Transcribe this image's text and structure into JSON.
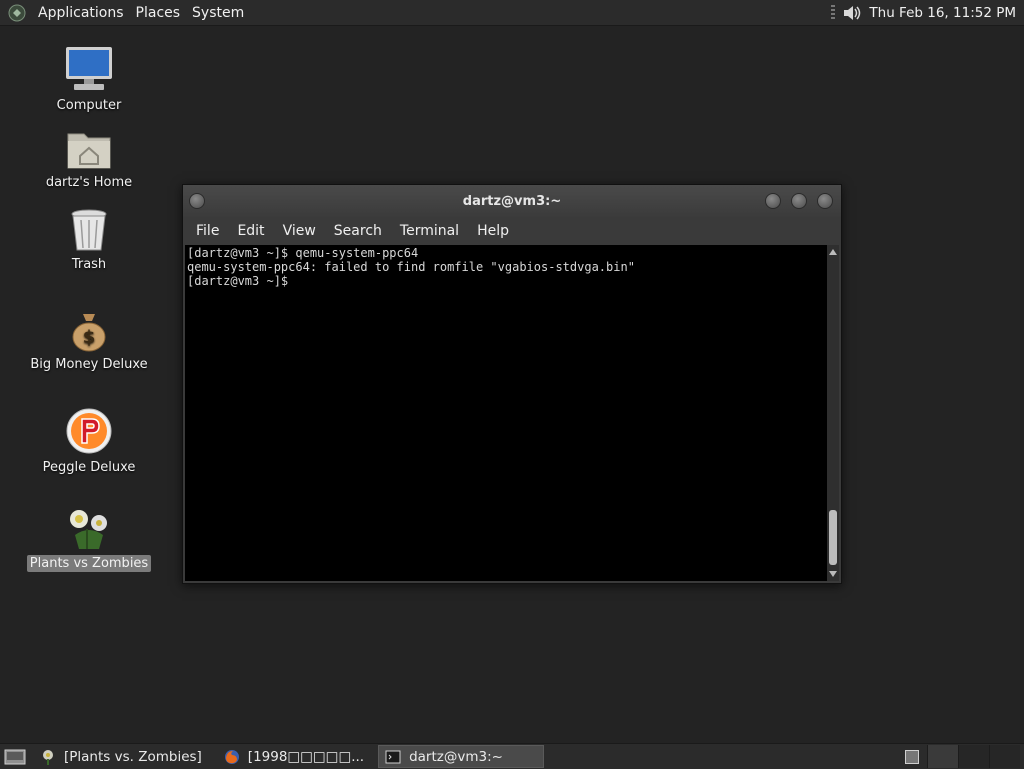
{
  "top_panel": {
    "menus": [
      "Applications",
      "Places",
      "System"
    ],
    "clock": "Thu Feb 16, 11:52 PM"
  },
  "desktop": {
    "icons": [
      {
        "label": "Computer",
        "icon": "computer-icon"
      },
      {
        "label": "dartz's Home",
        "icon": "home-folder-icon"
      },
      {
        "label": "Trash",
        "icon": "trash-icon"
      },
      {
        "label": "Big Money Deluxe",
        "icon": "money-bag-icon"
      },
      {
        "label": "Peggle Deluxe",
        "icon": "peggle-icon"
      },
      {
        "label": "Plants vs Zombies",
        "icon": "plants-vs-zombies-icon",
        "selected": true
      }
    ]
  },
  "terminal": {
    "title": "dartz@vm3:~",
    "menus": [
      "File",
      "Edit",
      "View",
      "Search",
      "Terminal",
      "Help"
    ],
    "lines": [
      "[dartz@vm3 ~]$ qemu-system-ppc64",
      "qemu-system-ppc64: failed to find romfile \"vgabios-stdvga.bin\"",
      "[dartz@vm3 ~]$ "
    ]
  },
  "taskbar": {
    "tasks": [
      {
        "label": "[Plants vs. Zombies]",
        "icon": "plants-vs-zombies-icon",
        "active": false
      },
      {
        "label": "[1998□□□□□...",
        "icon": "firefox-icon",
        "active": false
      },
      {
        "label": "dartz@vm3:~",
        "icon": "terminal-icon",
        "active": true
      }
    ]
  },
  "colors": {
    "desktop_bg": "#232323",
    "panel_bg": "#2b2b2b",
    "terminal_bg": "#000000",
    "selection_bg": "#7b7b7b"
  }
}
